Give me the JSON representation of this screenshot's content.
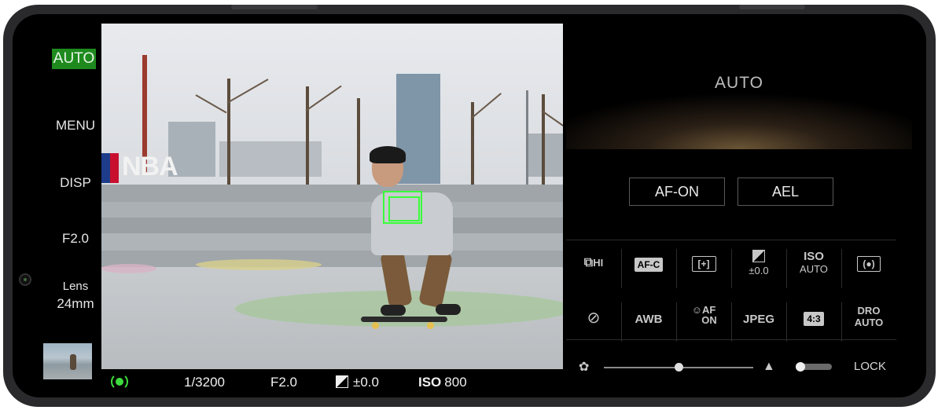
{
  "left_menu": {
    "mode_badge": "AUTO",
    "menu_label": "MENU",
    "disp_label": "DISP",
    "aperture_label": "F2.0",
    "lens_title": "Lens",
    "lens_value": "24mm"
  },
  "viewfinder": {
    "sign_text": "NBA"
  },
  "status_bar": {
    "shutter_speed": "1/3200",
    "aperture": "F2.0",
    "exposure_comp": "±0.0",
    "iso_label": "ISO",
    "iso_value": "800"
  },
  "right_panel": {
    "mode_title": "AUTO",
    "af_on_label": "AF-ON",
    "ael_label": "AEL",
    "settings_row1": [
      {
        "name": "drive-mode",
        "label": "HI",
        "icon": "continuous-shot-icon"
      },
      {
        "name": "focus-mode",
        "label": "AF-C",
        "icon": "af-c-icon"
      },
      {
        "name": "focus-area",
        "label": "",
        "icon": "focus-area-icon"
      },
      {
        "name": "exposure-comp",
        "label": "±0.0",
        "icon": "exposure-comp-icon"
      },
      {
        "name": "iso",
        "label": "ISO",
        "sub": "AUTO",
        "icon": "iso-icon"
      },
      {
        "name": "metering",
        "label": "",
        "icon": "metering-icon"
      }
    ],
    "settings_row2": [
      {
        "name": "flash",
        "label": "",
        "icon": "flash-off-icon"
      },
      {
        "name": "white-balance",
        "label": "AWB",
        "icon": "awb-icon"
      },
      {
        "name": "face-eye-af",
        "label": "AF",
        "sub": "ON",
        "icon": "face-af-icon"
      },
      {
        "name": "file-format",
        "label": "JPEG",
        "icon": "jpeg-icon"
      },
      {
        "name": "aspect-ratio",
        "label": "4:3",
        "icon": "aspect-ratio-icon"
      },
      {
        "name": "dro",
        "label": "DRO",
        "sub": "AUTO",
        "icon": "dro-icon"
      }
    ],
    "lock_label": "LOCK",
    "zoom_level": 0.5
  },
  "colors": {
    "accent_green": "#39ff39",
    "mode_badge_bg": "#1e8a1e"
  }
}
